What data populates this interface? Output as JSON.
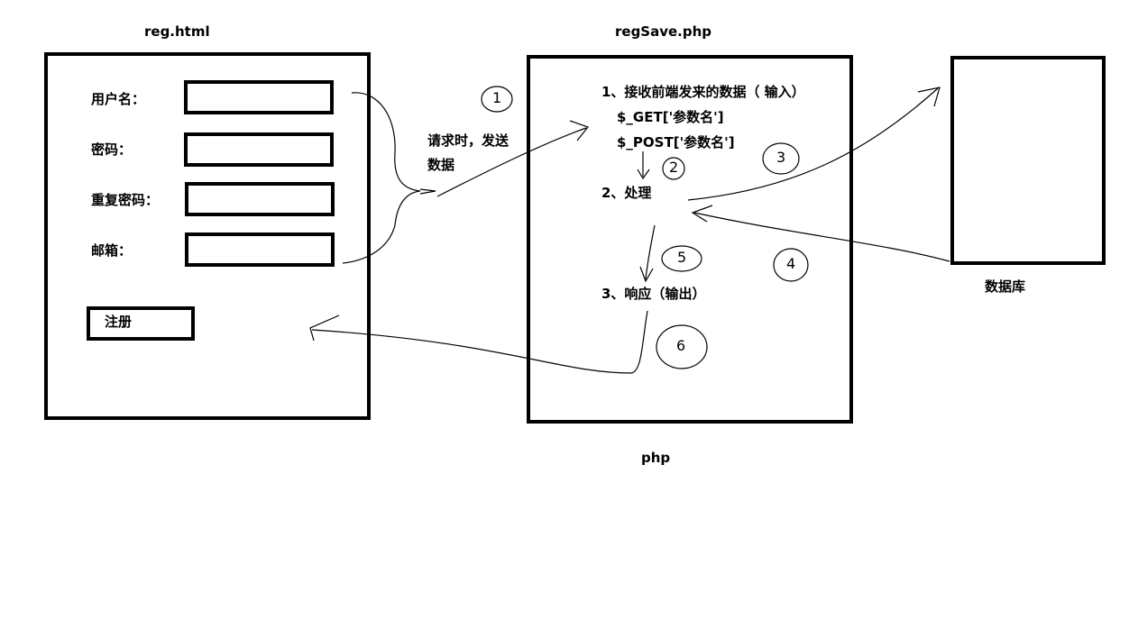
{
  "titles": {
    "reg": "reg.html",
    "regsave": "regSave.php",
    "php": "php",
    "db": "数据库"
  },
  "form": {
    "username_label": "用户名：",
    "password_label": "密码：",
    "repeat_password_label": "重复密码：",
    "email_label": "邮箱：",
    "register_button": "注册"
  },
  "request_note": {
    "line1": "请求时，发送",
    "line2": "数据"
  },
  "steps": {
    "step1": "1、接收前端发来的数据（ 输入）",
    "get": "$_GET['参数名']",
    "post": "$_POST['参数名']",
    "step2": "2、处理",
    "step3": "3、响应（输出）"
  },
  "markers": [
    "1",
    "2",
    "3",
    "4",
    "5",
    "6"
  ]
}
